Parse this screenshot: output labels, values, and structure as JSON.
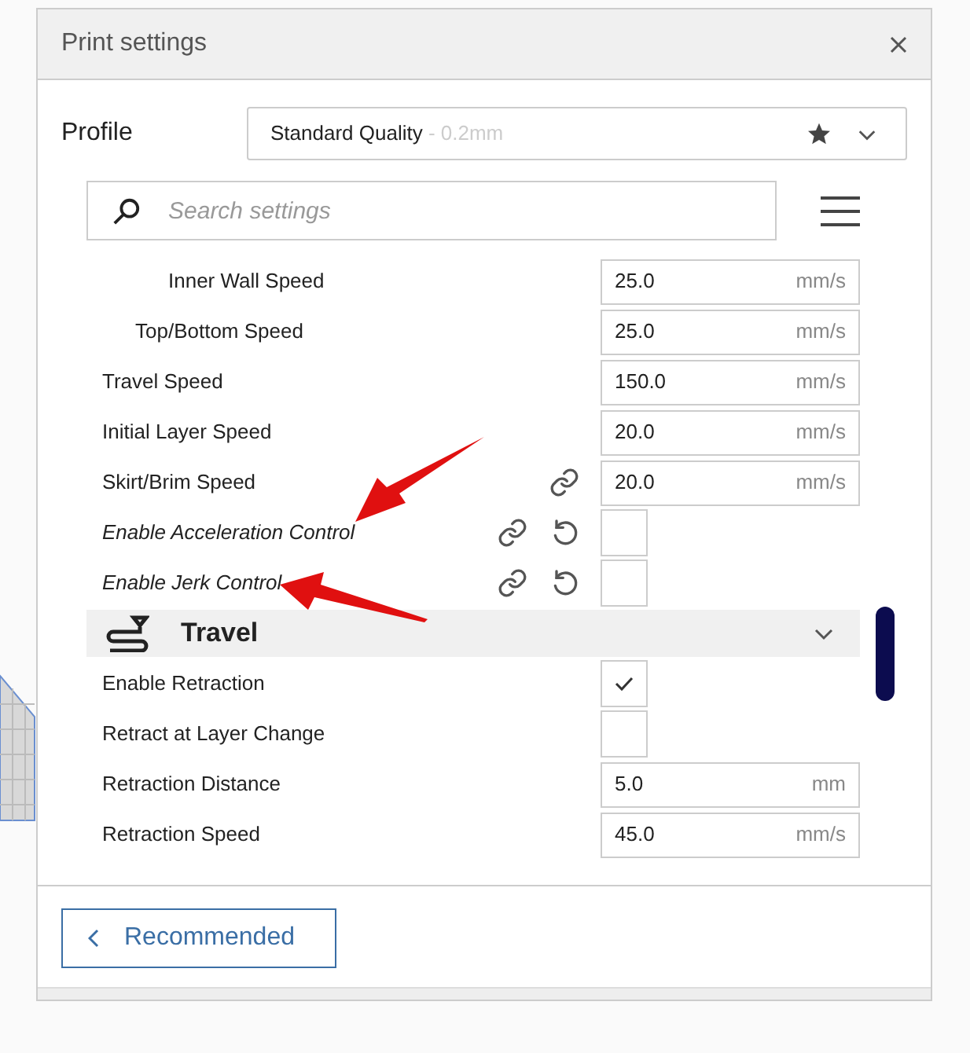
{
  "window": {
    "title": "Print settings"
  },
  "profile": {
    "label": "Profile",
    "value": "Standard Quality",
    "detail": " - 0.2mm"
  },
  "search": {
    "placeholder": "Search settings"
  },
  "settings": [
    {
      "children": [
        {
          "children": [
            {
              "label": "Inner Wall Speed",
              "italic": false,
              "kind": "field",
              "value": "25.0",
              "unit": "mm/s"
            }
          ]
        },
        {
          "label": "Top/Bottom Speed",
          "italic": false,
          "kind": "field",
          "value": "25.0",
          "unit": "mm/s"
        }
      ]
    },
    {
      "label": "Travel Speed",
      "italic": false,
      "kind": "field",
      "value": "150.0",
      "unit": "mm/s"
    },
    {
      "label": "Initial Layer Speed",
      "italic": false,
      "kind": "field",
      "value": "20.0",
      "unit": "mm/s"
    },
    {
      "label": "Skirt/Brim Speed",
      "italic": false,
      "kind": "field",
      "value": "20.0",
      "unit": "mm/s",
      "linked": true,
      "resettable": false
    },
    {
      "label": "Enable Acceleration Control",
      "italic": true,
      "kind": "checkbox",
      "checked": false,
      "linked": true,
      "resettable": true
    },
    {
      "label": "Enable Jerk Control",
      "italic": true,
      "kind": "checkbox",
      "checked": false,
      "linked": true,
      "resettable": true
    },
    {
      "kind": "category",
      "label": "Travel",
      "expanded": true
    },
    {
      "label": "Enable Retraction",
      "italic": false,
      "kind": "checkbox",
      "checked": true
    },
    {
      "label": "Retract at Layer Change",
      "italic": false,
      "kind": "checkbox",
      "checked": false
    },
    {
      "label": "Retraction Distance",
      "italic": false,
      "kind": "field",
      "value": "5.0",
      "unit": "mm"
    },
    {
      "label": "Retraction Speed",
      "italic": false,
      "kind": "field",
      "value": "45.0",
      "unit": "mm/s"
    }
  ],
  "footer": {
    "button": "Recommended"
  }
}
